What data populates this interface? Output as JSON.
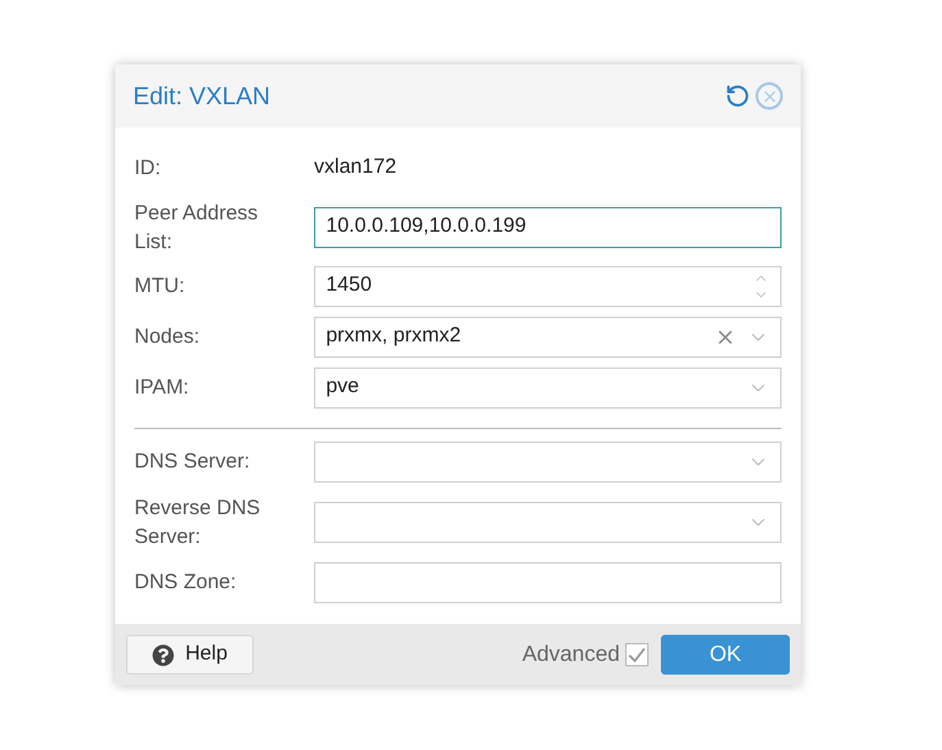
{
  "window": {
    "title": "Edit: VXLAN"
  },
  "sections": [
    {
      "fields": [
        {
          "label": "ID:",
          "kind": "display",
          "value": "vxlan172"
        },
        {
          "label": "Peer Address List:",
          "kind": "text",
          "value": "10.0.0.109,10.0.0.199",
          "focused": true
        },
        {
          "label": "MTU:",
          "kind": "number",
          "value": "1450"
        },
        {
          "label": "Nodes:",
          "kind": "combo",
          "value": "prxmx, prxmx2",
          "clearable": true
        },
        {
          "label": "IPAM:",
          "kind": "combo",
          "value": "pve"
        }
      ]
    },
    {
      "fields": [
        {
          "label": "DNS Server:",
          "kind": "combo"
        },
        {
          "label": "Reverse DNS Server:",
          "kind": "combo"
        },
        {
          "label": "DNS Zone:",
          "kind": "text"
        }
      ]
    }
  ],
  "footer": {
    "help": "Help",
    "advanced": {
      "label": "Advanced",
      "checked": true
    },
    "ok": "OK"
  }
}
